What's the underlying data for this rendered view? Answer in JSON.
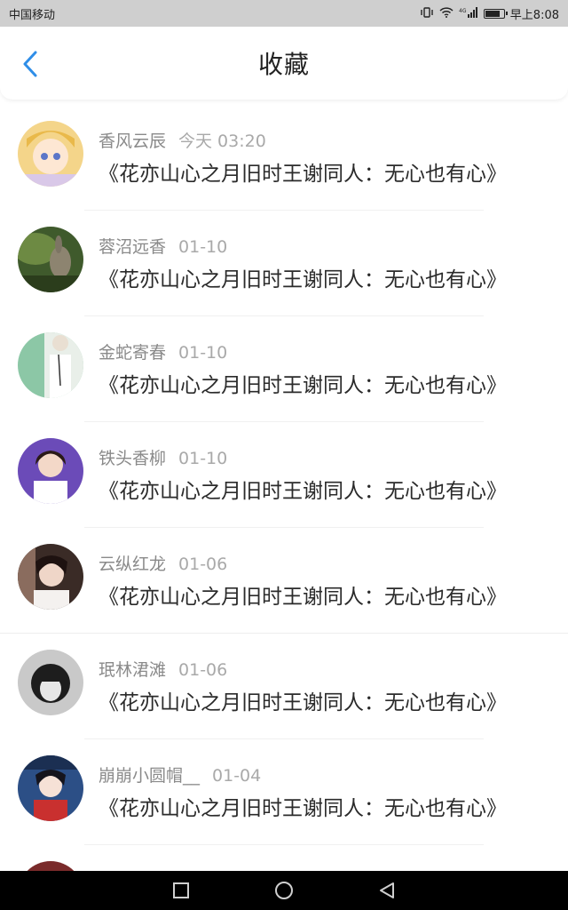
{
  "status_bar": {
    "carrier": "中国移动",
    "network": "4G",
    "time_label": "早上8:08"
  },
  "header": {
    "title": "收藏"
  },
  "items": [
    {
      "name": "香风云辰",
      "time": "今天 03:20",
      "book": "《花亦山心之月旧时王谢同人：无心也有心》"
    },
    {
      "name": "蓉沼远香",
      "time": "01-10",
      "book": "《花亦山心之月旧时王谢同人：无心也有心》"
    },
    {
      "name": "金蛇寄春",
      "time": "01-10",
      "book": "《花亦山心之月旧时王谢同人：无心也有心》"
    },
    {
      "name": "铁头香柳",
      "time": "01-10",
      "book": "《花亦山心之月旧时王谢同人：无心也有心》"
    },
    {
      "name": "云纵红龙",
      "time": "01-06",
      "book": "《花亦山心之月旧时王谢同人：无心也有心》"
    },
    {
      "name": "珉林涒滩",
      "time": "01-06",
      "book": "《花亦山心之月旧时王谢同人：无心也有心》"
    },
    {
      "name": "崩崩小圆帽__",
      "time": "01-04",
      "book": "《花亦山心之月旧时王谢同人：无心也有心》"
    }
  ],
  "colors": {
    "accent_blue": "#2f8ee8"
  }
}
